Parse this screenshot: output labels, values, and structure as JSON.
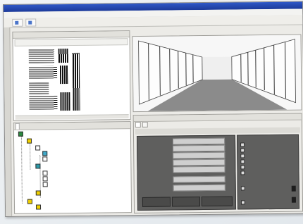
{
  "window": {
    "title": "",
    "menu": [
      "",
      ""
    ]
  },
  "toolbar": {
    "buttons": [
      "",
      ""
    ]
  },
  "elevation_panel": {
    "header": "",
    "bar_label": "",
    "bar_value": ""
  },
  "tree_panel": {
    "tabs": [
      "",
      "",
      ""
    ],
    "nodes": [
      "",
      "",
      "",
      "",
      "",
      "",
      "",
      "",
      "",
      "",
      "",
      ""
    ],
    "selected_index": 3
  },
  "view3d": {
    "header": "",
    "corner_label": ""
  },
  "properties": {
    "header": "",
    "tabs": [
      "",
      ""
    ],
    "subheader": "",
    "fields": [
      {
        "label": "",
        "value": ""
      },
      {
        "label": "",
        "value": ""
      },
      {
        "label": "",
        "value": ""
      },
      {
        "label": "",
        "value": ""
      },
      {
        "label": "",
        "value": ""
      },
      {
        "label": "",
        "value": ""
      },
      {
        "label": "",
        "value": ""
      }
    ],
    "checkboxes": [
      "",
      "",
      "",
      "",
      "",
      "",
      "",
      ""
    ],
    "buttons": [
      "",
      "",
      ""
    ],
    "right_sections": [
      "",
      ""
    ]
  },
  "colors": {
    "accent": "#2f58c7",
    "selection": "#3a5fc6",
    "panel_dark": "#5f5f5e"
  }
}
